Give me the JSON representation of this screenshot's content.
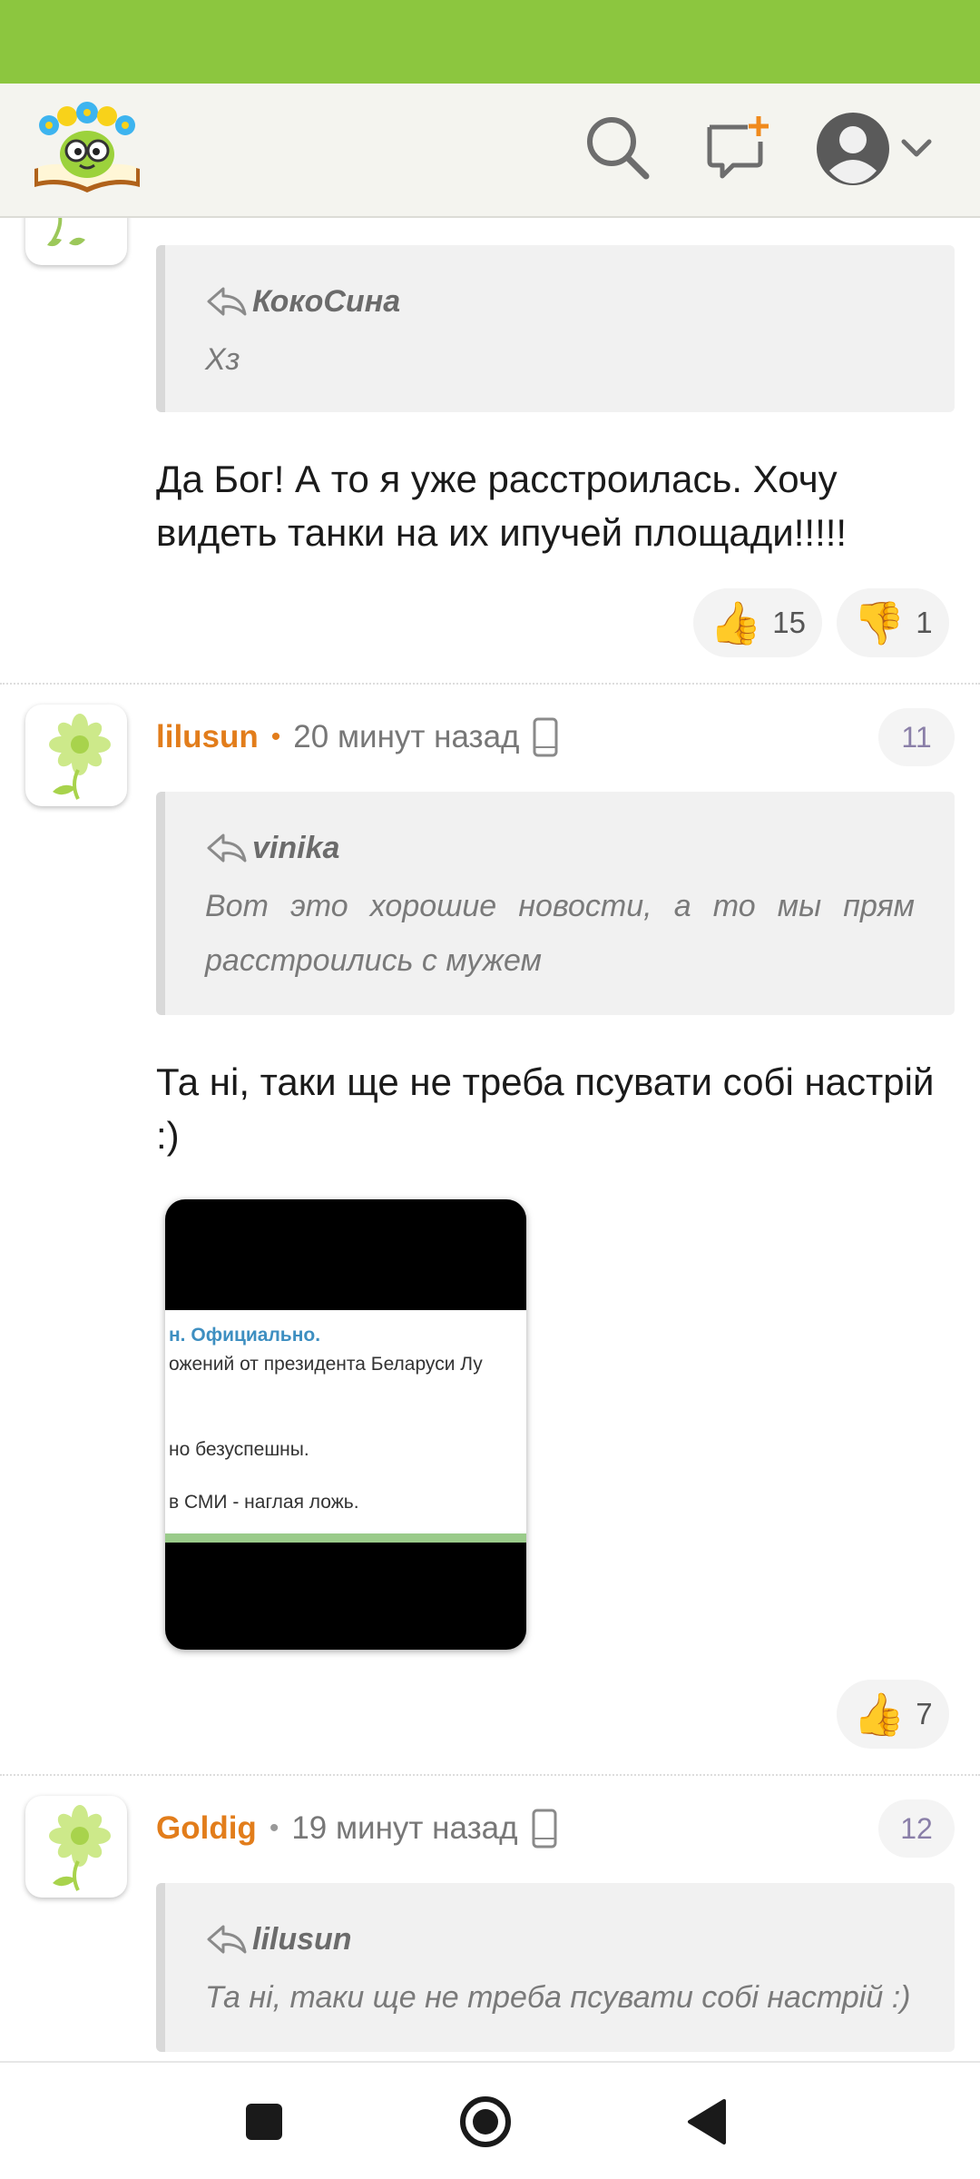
{
  "header": {
    "logo_icon": "book-with-flower-wreath-logo",
    "search_icon": "search-icon",
    "new_topic_icon": "comment-plus-icon",
    "profile_icon": "avatar-icon",
    "colors": {
      "statusbar": "#8cc63f",
      "header_bg": "#f4f4ef",
      "accent": "#e27d1b"
    }
  },
  "comments": [
    {
      "quote": {
        "author": "КокоСина",
        "text": "Хз"
      },
      "text": "Да Бог! А то я уже расстроилась. Хочу видеть танки на их ипучей площади!!!!!",
      "likes": "15",
      "dislikes": "1"
    },
    {
      "author": "lilusun",
      "time": "20 минут назад",
      "number": "11",
      "quote": {
        "author": "vinika",
        "text": "Вот это хорошие новости, а то мы прям расстроились с мужем"
      },
      "text": "Та ні, таки ще не треба псувати собі настрій :)",
      "attachment": {
        "lines": [
          "н. Официально.",
          "ожений от президента Беларуси Лу",
          "но безуспешны.",
          "в СМИ - наглая ложь."
        ]
      },
      "likes": "7"
    },
    {
      "author": "Goldig",
      "time": "19 минут назад",
      "number": "12",
      "quote": {
        "author": "lilusun",
        "text": "Та ні, таки ще не треба псувати собі настрій :)"
      }
    }
  ],
  "navbar": {
    "recent_icon": "square-icon",
    "home_icon": "circle-icon",
    "back_icon": "triangle-back-icon"
  }
}
